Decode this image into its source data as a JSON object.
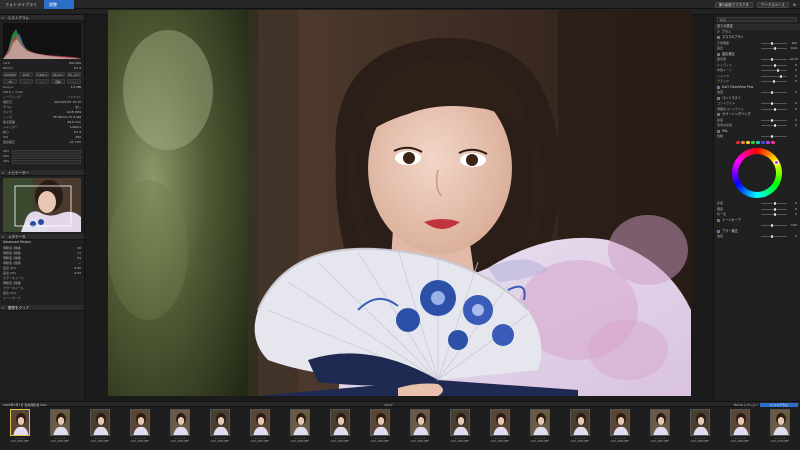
{
  "tabs": [
    {
      "label": "フォトライブラリ"
    },
    {
      "label": "調整"
    }
  ],
  "topright": {
    "btn1": "第2画面でマネクタ",
    "btn2": "ワークスペース"
  },
  "toolbar": {
    "zoom": "50 %",
    "mode1": "画像比較"
  },
  "left": {
    "histogram_title": "ヒストグラム",
    "exif_rows": [
      {
        "k": "1/16",
        "v": "ISO 200"
      },
      {
        "k": "85mm",
        "v": "f/1.4"
      }
    ],
    "btns1": [
      "ISO 800",
      "f/2.8",
      "1/400 s",
      "85 mm",
      "EV +0.7"
    ],
    "btns2": [
      "16",
      "—",
      "—",
      "自動",
      "—"
    ],
    "info_rows": [
      {
        "k": "Sony α",
        "v": "4.4 MB"
      },
      {
        "k": "5616 × 3744",
        "v": ""
      },
      {
        "k": "レーティング",
        "v": "☆☆☆☆☆"
      },
      {
        "k": "撮影日",
        "v": "2024/07/07 15:15"
      },
      {
        "k": "ラベル",
        "v": "なし"
      },
      {
        "k": "カメラ",
        "v": "ILCE-7M4"
      },
      {
        "k": "レンズ",
        "v": "FE 85mm F1.4 GM"
      },
      {
        "k": "焦点距離",
        "v": "85.0 mm"
      },
      {
        "k": "シャッター",
        "v": "1/400 s"
      },
      {
        "k": "絞り",
        "v": "f/1.4"
      },
      {
        "k": "ISO",
        "v": "200"
      },
      {
        "k": "露出補正",
        "v": "+0.7 EV"
      }
    ],
    "nav_title": "ナビゲーター",
    "meta_title": "メタデータ",
    "meta_sub": "Advanced History",
    "meta_rows": [
      {
        "k": "明瞭度 (微細)",
        "v": "30"
      },
      {
        "k": "明瞭度 (微細)",
        "v": "17"
      },
      {
        "k": "明瞭度 (微細)",
        "v": "24"
      },
      {
        "k": "明瞭度 (微細)",
        "v": "—"
      },
      {
        "k": "露出 (EV)",
        "v": "0.50"
      },
      {
        "k": "露出 (EV)",
        "v": "0.52"
      },
      {
        "k": "カラーホイール",
        "v": ""
      },
      {
        "k": "明瞭度 (微細)",
        "v": ""
      },
      {
        "k": "カラーホイール",
        "v": ""
      },
      {
        "k": "露出 (EV)",
        "v": ""
      },
      {
        "k": "トーンカーブ",
        "v": ""
      }
    ],
    "footer": "履歴をクリア"
  },
  "right": {
    "search_placeholder": "検索",
    "preset_label": "全ての設定",
    "tool_label": "ブラシ",
    "sections": [
      {
        "title": "マスク&ブラシ",
        "rows": [
          {
            "n": "不透明度",
            "v": "100"
          },
          {
            "n": "露出",
            "v": "0.00"
          }
        ]
      },
      {
        "title": "露出補正",
        "rows": [
          {
            "n": "露光量",
            "v": "+0.70"
          },
          {
            "n": "ハイライト",
            "v": "0"
          },
          {
            "n": "中間トーン",
            "v": "0"
          },
          {
            "n": "シャドウ",
            "v": "0"
          },
          {
            "n": "ブラック",
            "v": "0"
          }
        ]
      },
      {
        "title": "DxO ClearView Plus",
        "rows": [
          {
            "n": "強度",
            "v": "0"
          }
        ]
      },
      {
        "title": "コントラスト",
        "rows": [
          {
            "n": "コントラスト",
            "v": "0"
          },
          {
            "n": "微細なコントラスト",
            "v": "0"
          }
        ]
      },
      {
        "title": "カラーレンダリング",
        "rows": [
          {
            "n": "彩度",
            "v": "0"
          },
          {
            "n": "自然な彩度",
            "v": "0"
          }
        ]
      },
      {
        "title": "HSL",
        "rows": [
          {
            "n": "色相",
            "v": ""
          }
        ]
      }
    ],
    "wheel_rows": [
      {
        "n": "彩度",
        "v": "0"
      },
      {
        "n": "輝度",
        "v": "0"
      },
      {
        "n": "均一性",
        "v": "0"
      }
    ],
    "bottom_sections": [
      {
        "title": "トーンカーブ",
        "rows": [
          {
            "n": "",
            "v": "0.00"
          }
        ]
      },
      {
        "title": "ブラー補正",
        "rows": [
          {
            "n": "強度",
            "v": "0"
          }
        ]
      }
    ],
    "swatch_colors": [
      "#e23",
      "#e82",
      "#ed2",
      "#3c3",
      "#2cc",
      "#35e",
      "#c3e",
      "#e3a"
    ]
  },
  "filmstrip": {
    "path": "2024年7月7日 浴衣撮影会 DSC",
    "count": "1/177",
    "btn1": "Filmキャプション",
    "btn2": "ヒストグラム",
    "frames": [
      "DSC_0051.NEF",
      "DSC_0052.NEF",
      "DSC_0053.NEF",
      "DSC_0054.NEF",
      "DSC_0055.NEF",
      "DSC_0056.NEF",
      "DSC_0057.NEF",
      "DSC_0058.NEF",
      "DSC_0059.NEF",
      "DSC_0060.NEF",
      "DSC_0061.NEF",
      "DSC_0062.NEF",
      "DSC_0063.NEF",
      "DSC_0064.NEF",
      "DSC_0065.NEF",
      "DSC_0066.NEF",
      "DSC_0067.NEF",
      "DSC_0068.NEF",
      "DSC_0069.NEF",
      "DSC_0070.NEF"
    ]
  }
}
